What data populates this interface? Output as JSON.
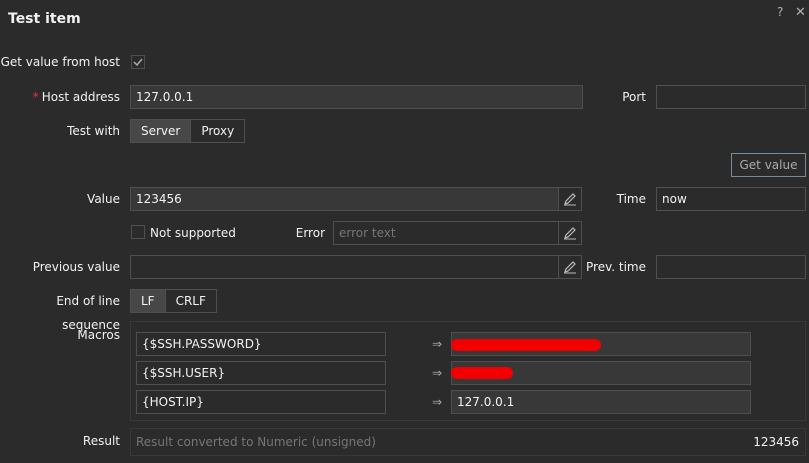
{
  "dialog": {
    "title": "Test item",
    "help_icon": "?",
    "close_icon": "✕"
  },
  "get_value_from_host": {
    "label": "Get value from host",
    "checked": true
  },
  "host_address": {
    "label": "Host address",
    "value": "127.0.0.1",
    "required_mark": "*"
  },
  "port": {
    "label": "Port",
    "value": ""
  },
  "test_with": {
    "label": "Test with",
    "options": [
      "Server",
      "Proxy"
    ],
    "selected": "Server"
  },
  "get_value_button": {
    "label": "Get value"
  },
  "value": {
    "label": "Value",
    "value": "123456"
  },
  "time": {
    "label": "Time",
    "value": "now"
  },
  "not_supported": {
    "label": "Not supported",
    "checked": false
  },
  "error": {
    "label": "Error",
    "placeholder": "error text"
  },
  "previous_value": {
    "label": "Previous value",
    "value": ""
  },
  "prev_time": {
    "label": "Prev. time",
    "value": ""
  },
  "eol": {
    "label": "End of line sequence",
    "options": [
      "LF",
      "CRLF"
    ],
    "selected": "LF"
  },
  "macros": {
    "label": "Macros",
    "arrow": "⇒",
    "rows": [
      {
        "name": "{$SSH.PASSWORD}",
        "value": "",
        "redacted": true
      },
      {
        "name": "{$SSH.USER}",
        "value": "",
        "redacted": true
      },
      {
        "name": "{HOST.IP}",
        "value": "127.0.0.1",
        "redacted": false
      }
    ]
  },
  "result": {
    "label": "Result",
    "placeholder": "Result converted to Numeric (unsigned)",
    "value": "123456"
  }
}
